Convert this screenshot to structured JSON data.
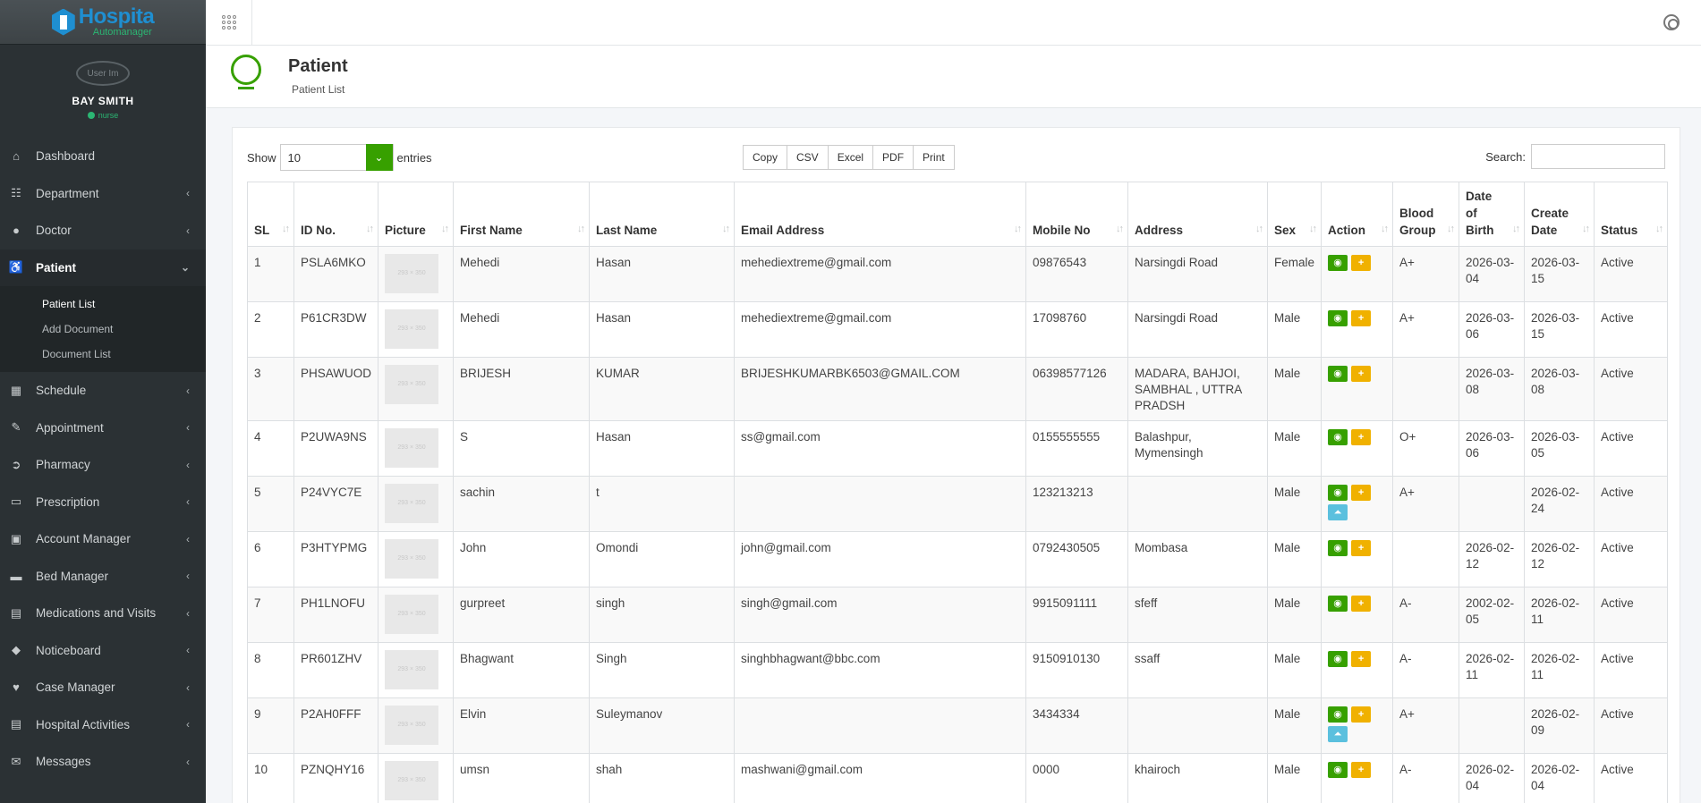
{
  "brand": {
    "title": "Hospita",
    "subtitle": "Automanager"
  },
  "user": {
    "name": "BAY SMITH",
    "role": "nurse",
    "avatar_alt": "User Im"
  },
  "sidebar": {
    "items": [
      {
        "label": "Dashboard",
        "icon": "home-icon"
      },
      {
        "label": "Department",
        "icon": "sitemap-icon"
      },
      {
        "label": "Doctor",
        "icon": "user-md-icon"
      },
      {
        "label": "Patient",
        "icon": "wheelchair-icon"
      },
      {
        "label": "Schedule",
        "icon": "calendar-icon"
      },
      {
        "label": "Appointment",
        "icon": "edit-icon"
      },
      {
        "label": "Pharmacy",
        "icon": "arrow-circle-icon"
      },
      {
        "label": "Prescription",
        "icon": "book-icon"
      },
      {
        "label": "Account Manager",
        "icon": "briefcase-icon"
      },
      {
        "label": "Bed Manager",
        "icon": "bed-icon"
      },
      {
        "label": "Medications and Visits",
        "icon": "clipboard-icon"
      },
      {
        "label": "Noticeboard",
        "icon": "bell-icon"
      },
      {
        "label": "Case Manager",
        "icon": "heartbeat-icon"
      },
      {
        "label": "Hospital Activities",
        "icon": "clipboard-icon"
      },
      {
        "label": "Messages",
        "icon": "comments-icon"
      }
    ],
    "patient_sub": [
      "Patient List",
      "Add Document",
      "Document List"
    ]
  },
  "page": {
    "title": "Patient",
    "subtitle": "Patient List"
  },
  "controls": {
    "show_label": "Show",
    "entries_label": "entries",
    "page_size": "10",
    "buttons": [
      "Copy",
      "CSV",
      "Excel",
      "PDF",
      "Print"
    ],
    "search_label": "Search:",
    "search_value": ""
  },
  "table": {
    "headers": {
      "sl": "SL",
      "id": "ID No.",
      "picture": "Picture",
      "first": "First Name",
      "last": "Last Name",
      "email": "Email Address",
      "mobile": "Mobile No",
      "address": "Address",
      "sex": "Sex",
      "action": "Action",
      "blood": "Blood Group",
      "dob": "Date of Birth",
      "created": "Create Date",
      "status": "Status"
    },
    "placeholder_text": "293 × 350",
    "rows": [
      {
        "sl": "1",
        "id": "PSLA6MKO",
        "first": "Mehedi",
        "last": "Hasan",
        "email": "mehediextreme@gmail.com",
        "mobile": "09876543",
        "address": "Narsingdi Road",
        "sex": "Female",
        "blood": "A+",
        "dob": "2026-03-04",
        "created": "2026-03-15",
        "status": "Active",
        "upload": false
      },
      {
        "sl": "2",
        "id": "P61CR3DW",
        "first": "Mehedi",
        "last": "Hasan",
        "email": "mehediextreme@gmail.com",
        "mobile": "17098760",
        "address": "Narsingdi Road",
        "sex": "Male",
        "blood": "A+",
        "dob": "2026-03-06",
        "created": "2026-03-15",
        "status": "Active",
        "upload": false
      },
      {
        "sl": "3",
        "id": "PHSAWUOD",
        "first": "BRIJESH",
        "last": "KUMAR",
        "email": "BRIJESHKUMARBK6503@GMAIL.COM",
        "mobile": "06398577126",
        "address": "MADARA, BAHJOI, SAMBHAL , UTTRA PRADSH",
        "sex": "Male",
        "blood": "",
        "dob": "2026-03-08",
        "created": "2026-03-08",
        "status": "Active",
        "upload": false
      },
      {
        "sl": "4",
        "id": "P2UWA9NS",
        "first": "S",
        "last": "Hasan",
        "email": "ss@gmail.com",
        "mobile": "0155555555",
        "address": "Balashpur, Mymensingh",
        "sex": "Male",
        "blood": "O+",
        "dob": "2026-03-06",
        "created": "2026-03-05",
        "status": "Active",
        "upload": false
      },
      {
        "sl": "5",
        "id": "P24VYC7E",
        "first": "sachin",
        "last": "t",
        "email": "",
        "mobile": "123213213",
        "address": "",
        "sex": "Male",
        "blood": "A+",
        "dob": "",
        "created": "2026-02-24",
        "status": "Active",
        "upload": true
      },
      {
        "sl": "6",
        "id": "P3HTYPMG",
        "first": "John",
        "last": "Omondi",
        "email": "john@gmail.com",
        "mobile": "0792430505",
        "address": "Mombasa",
        "sex": "Male",
        "blood": "",
        "dob": "2026-02-12",
        "created": "2026-02-12",
        "status": "Active",
        "upload": false
      },
      {
        "sl": "7",
        "id": "PH1LNOFU",
        "first": "gurpreet",
        "last": "singh",
        "email": "singh@gmail.com",
        "mobile": "9915091111",
        "address": "sfeff",
        "sex": "Male",
        "blood": "A-",
        "dob": "2002-02-05",
        "created": "2026-02-11",
        "status": "Active",
        "upload": false
      },
      {
        "sl": "8",
        "id": "PR601ZHV",
        "first": "Bhagwant",
        "last": "Singh",
        "email": "singhbhagwant@bbc.com",
        "mobile": "9150910130",
        "address": "ssaff",
        "sex": "Male",
        "blood": "A-",
        "dob": "2026-02-11",
        "created": "2026-02-11",
        "status": "Active",
        "upload": false
      },
      {
        "sl": "9",
        "id": "P2AH0FFF",
        "first": "Elvin",
        "last": "Suleymanov",
        "email": "",
        "mobile": "3434334",
        "address": "",
        "sex": "Male",
        "blood": "A+",
        "dob": "",
        "created": "2026-02-09",
        "status": "Active",
        "upload": true
      },
      {
        "sl": "10",
        "id": "PZNQHY16",
        "first": "umsn",
        "last": "shah",
        "email": "mashwani@gmail.com",
        "mobile": "0000",
        "address": "khairoch",
        "sex": "Male",
        "blood": "A-",
        "dob": "2026-02-04",
        "created": "2026-02-04",
        "status": "Active",
        "upload": false
      }
    ]
  },
  "colors": {
    "sidebar": "#2b3134",
    "accent_green": "#37a000",
    "warning": "#f0b100",
    "info": "#5bc0de"
  }
}
